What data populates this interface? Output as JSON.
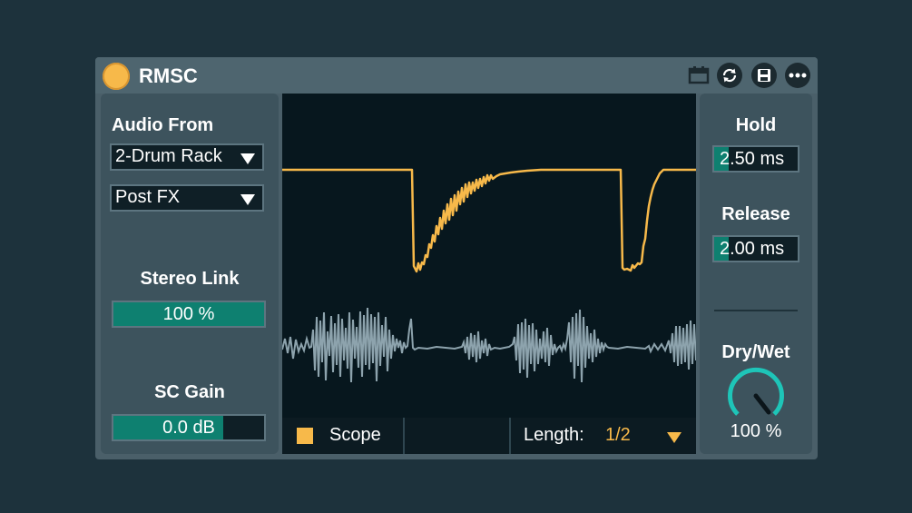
{
  "title": "RMSC",
  "icons": [
    "power-icon",
    "calendar-icon",
    "sync-icon",
    "save-icon",
    "more-icon"
  ],
  "left": {
    "audio_from_label": "Audio From",
    "audio_from_value": "2-Drum Rack",
    "tap_value": "Post FX",
    "stereo_link_label": "Stereo Link",
    "stereo_link_value": "100 %",
    "stereo_link_fraction": 1.0,
    "sc_gain_label": "SC Gain",
    "sc_gain_value": "0.0 dB",
    "sc_gain_fraction": 0.73
  },
  "right": {
    "hold_label": "Hold",
    "hold_value": "2.50 ms",
    "hold_fraction": 0.17,
    "release_label": "Release",
    "release_value": "2.00 ms",
    "release_fraction": 0.17,
    "drywet_label": "Dry/Wet",
    "drywet_value": "100 %",
    "drywet_fraction": 1.0
  },
  "scope": {
    "scope_label": "Scope",
    "scope_enabled": true,
    "length_label": "Length:",
    "length_value": "1/2"
  },
  "colors": {
    "accent": "#f7b94a",
    "teal": "#0e8070",
    "knob": "#1ec5b8",
    "display_bg": "#07171e",
    "panel": "#3d535d",
    "waveform": "#8da3ad"
  }
}
